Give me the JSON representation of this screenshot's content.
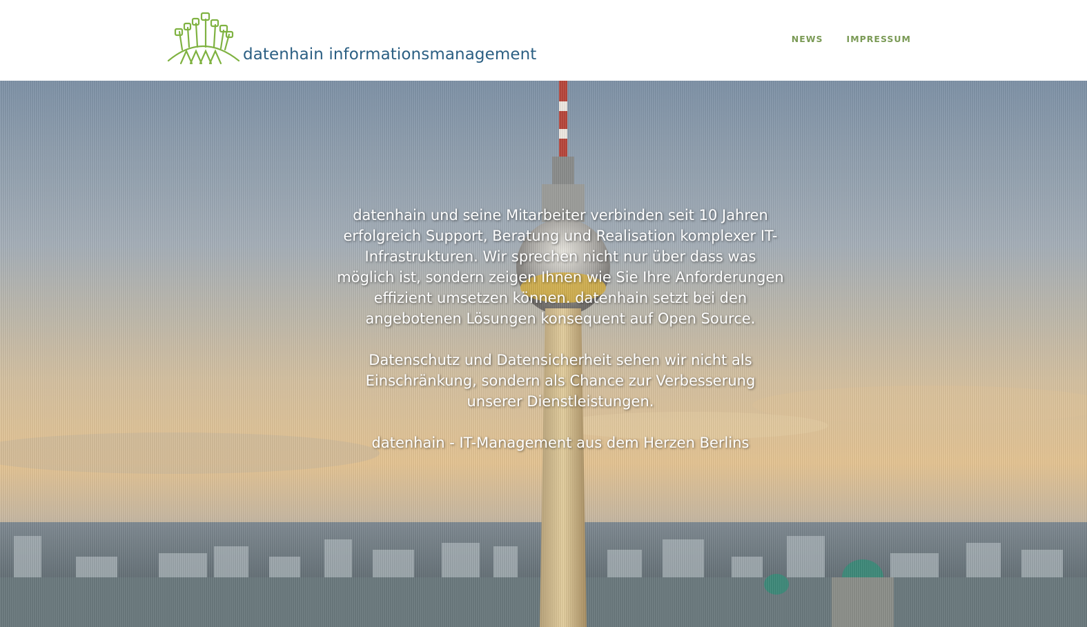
{
  "header": {
    "logo_text": "datenhain informationsmanagement",
    "nav": [
      {
        "label": "NEWS"
      },
      {
        "label": "IMPRESSUM"
      }
    ]
  },
  "hero": {
    "paragraphs": [
      "datenhain und seine Mitarbeiter verbinden seit 10 Jahren erfolgreich Support, Beratung und Realisation komplexer IT-Infrastrukturen. Wir sprechen nicht nur über dass was möglich ist, sondern zeigen Ihnen wie Sie Ihre Anforderungen effizient umsetzen können. datenhain setzt bei den angebotenen Lösungen konsequent auf Open Source.",
      "Datenschutz und Datensicherheit sehen wir nicht als Einschränkung, sondern als Chance zur Verbesserung unserer Dienstleistungen.",
      "datenhain - IT-Management aus dem Herzen Berlins"
    ]
  },
  "colors": {
    "logo_blue": "#2b5f83",
    "logo_green": "#7fb241",
    "nav_green": "#7a9a55"
  }
}
